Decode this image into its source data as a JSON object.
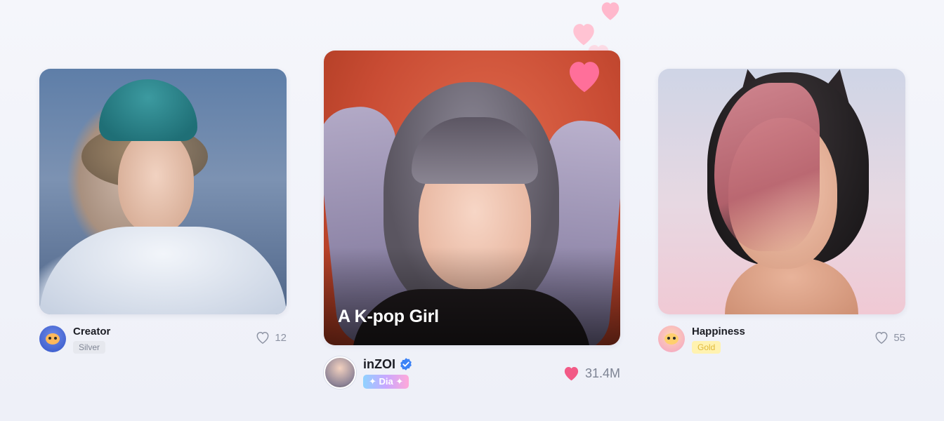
{
  "cards": [
    {
      "id": "left",
      "creator": "Creator",
      "badge": "Silver",
      "likes": "12",
      "liked": false
    },
    {
      "id": "center",
      "title": "A K-pop Girl",
      "creator": "inZOI",
      "verified": true,
      "badge": "✦ Dia ✦",
      "likes": "31.4M",
      "liked": true
    },
    {
      "id": "right",
      "creator": "Happiness",
      "badge": "Gold",
      "likes": "55",
      "liked": false
    }
  ],
  "icons": {
    "like_outline": "heart-outline-icon",
    "like_filled": "heart-filled-icon",
    "verified": "verified-badge-icon"
  },
  "colors": {
    "heart_filled": "#f25a86",
    "floating_heart": "#ffb3c8",
    "verified": "#3b82f6",
    "silver_badge_bg": "#e6e8ee",
    "gold_badge_bg": "#fff2b0",
    "page_bg": "#f3f4fa"
  }
}
